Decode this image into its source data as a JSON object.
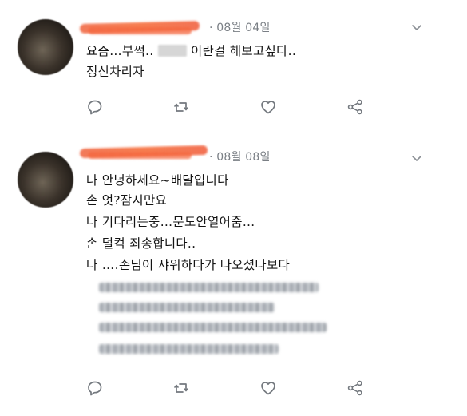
{
  "tweets": [
    {
      "date": "· 08월 04일",
      "lines": [
        "요즘…부쩍..",
        "이란걸 해보고싶다..",
        "정신차리자"
      ],
      "actions": [
        "reply-icon",
        "retweet-icon",
        "like-icon",
        "share-icon"
      ]
    },
    {
      "date": "· 08월 08일",
      "lines": [
        "나 안녕하세요~배달입니다",
        "손 엇?잠시만요",
        "나 기다리는중…문도안열어줌…",
        "손 덜컥 죄송합니다..",
        "나 ….손님이 샤워하다가 나오셨나보다"
      ],
      "actions": [
        "reply-icon",
        "retweet-icon",
        "like-icon",
        "share-icon"
      ]
    }
  ],
  "colors": {
    "icon": "#73787e",
    "date": "#7a7f85",
    "scribble": "#f26a42",
    "text": "#141414"
  }
}
